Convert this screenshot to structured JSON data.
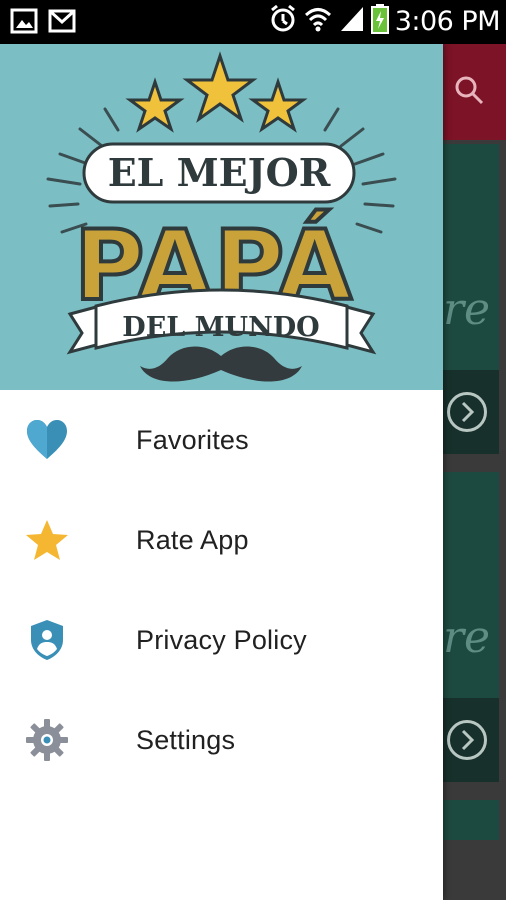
{
  "status_bar": {
    "time": "3:06 PM",
    "left_icons": [
      "gallery-notification-icon",
      "gmail-notification-icon"
    ],
    "right_icons": [
      "alarm-icon",
      "wifi-icon",
      "cell-signal-icon",
      "battery-charging-icon"
    ]
  },
  "drawer": {
    "header_art": {
      "line1": "EL MEJOR",
      "line2": "PAPÁ",
      "line3": "DEL MUNDO"
    },
    "menu": [
      {
        "label": "Favorites",
        "icon": "heart-icon",
        "color": "#3a8fb7"
      },
      {
        "label": "Rate App",
        "icon": "star-icon",
        "color": "#f5b731"
      },
      {
        "label": "Privacy Policy",
        "icon": "shield-user-icon",
        "color": "#3a8fb7"
      },
      {
        "label": "Settings",
        "icon": "gear-icon",
        "color": "#8a8f99"
      }
    ]
  },
  "background_app": {
    "toolbar_color": "#7c1326",
    "card_script_text": "re",
    "icons": [
      "search-icon",
      "chevron-right-circle-icon"
    ]
  }
}
